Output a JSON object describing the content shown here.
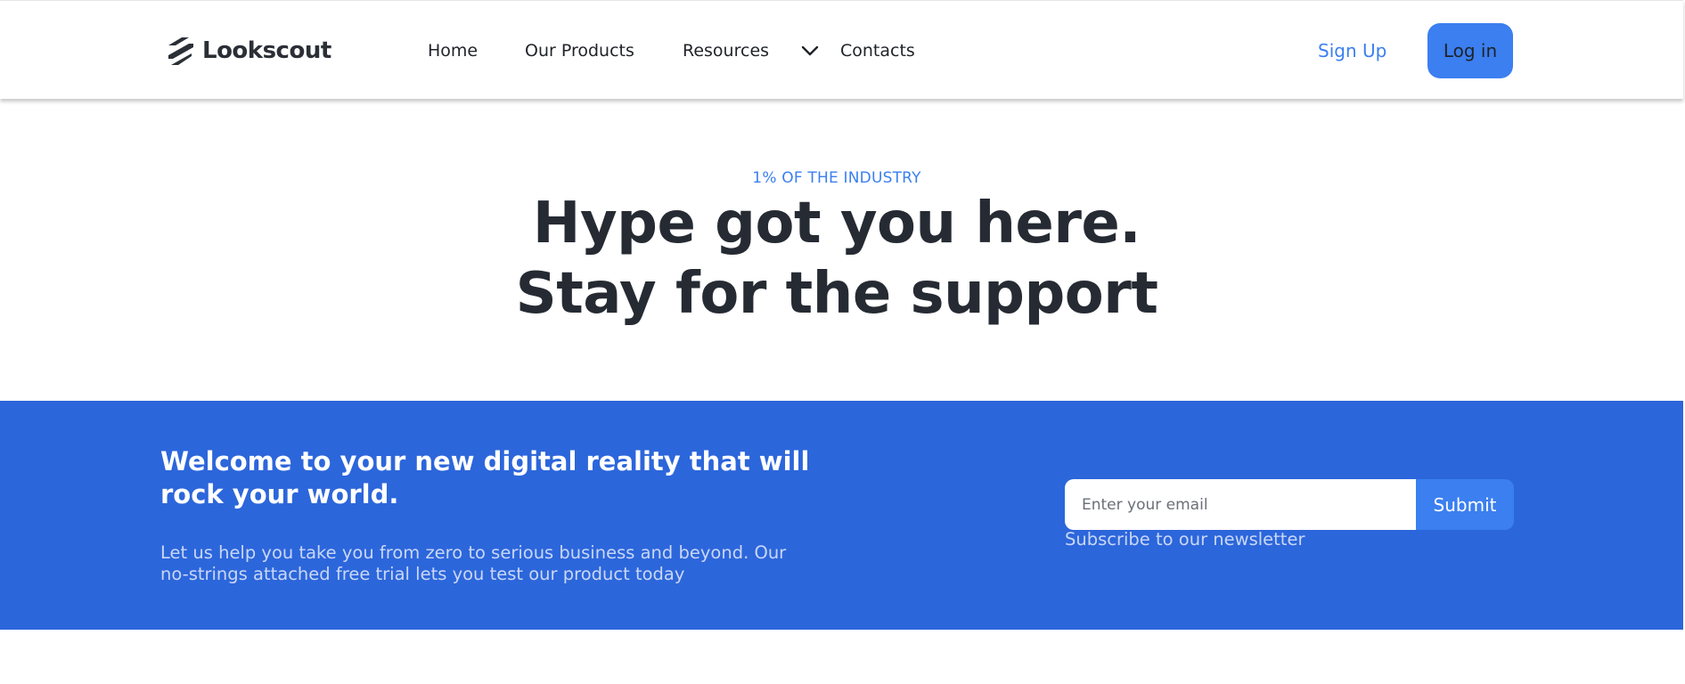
{
  "header": {
    "logo_text": "Lookscout",
    "nav": {
      "home": "Home",
      "products": "Our Products",
      "resources": "Resources",
      "contacts": "Contacts"
    },
    "signup_label": "Sign Up",
    "login_label": "Log in"
  },
  "hero": {
    "eyebrow": "1% OF THE INDUSTRY",
    "title_line1": "Hype got you here.",
    "title_line2": "Stay for the support"
  },
  "newsletter": {
    "heading": "Welcome to your new digital reality that will rock your world.",
    "body": "Let us help you take you from zero to serious business and beyond. Our no-strings attached free trial lets you test our product today",
    "email_placeholder": "Enter your email",
    "email_value": "",
    "submit_label": "Submit",
    "note": "Subscribe to our newsletter"
  },
  "colors": {
    "accent": "#3b7ff0",
    "band": "#2c66db",
    "heading_dark": "#262b33",
    "muted_on_blue": "#c9d7f6"
  },
  "icons": {
    "logo": "logo-mark-icon",
    "resources_dropdown": "chevron-down-icon"
  }
}
